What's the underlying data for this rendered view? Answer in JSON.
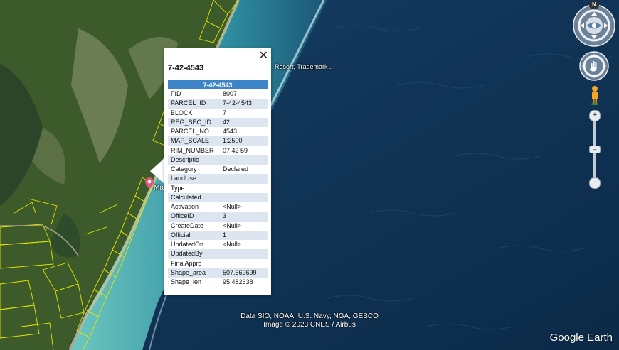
{
  "balloon": {
    "close_glyph": "✕",
    "title": "7-42-4543",
    "table_header": "7-42-4543",
    "rows": [
      {
        "key": "FID",
        "value": "8007"
      },
      {
        "key": "PARCEL_ID",
        "value": "7-42-4543"
      },
      {
        "key": "BLOCK",
        "value": "7"
      },
      {
        "key": "REG_SEC_ID",
        "value": "42"
      },
      {
        "key": "PARCEL_NO",
        "value": "4543"
      },
      {
        "key": "MAP_SCALE",
        "value": "1:2500"
      },
      {
        "key": "RIM_NUMBER",
        "value": "07 42 59"
      },
      {
        "key": "Descriptio",
        "value": ""
      },
      {
        "key": "Category",
        "value": "Declared"
      },
      {
        "key": "LandUse",
        "value": ""
      },
      {
        "key": "Type",
        "value": ""
      },
      {
        "key": "Calculated",
        "value": ""
      },
      {
        "key": "Activation",
        "value": "<Null>"
      },
      {
        "key": "OfficeID",
        "value": "3"
      },
      {
        "key": "CreateDate",
        "value": "<Null>"
      },
      {
        "key": "Official",
        "value": "1"
      },
      {
        "key": "UpdatedOn",
        "value": "<Null>"
      },
      {
        "key": "UpdatedBy",
        "value": ""
      },
      {
        "key": "FinalAppro",
        "value": ""
      },
      {
        "key": "Shape_area",
        "value": "507.669699"
      },
      {
        "key": "Shape_len",
        "value": "95.482638"
      }
    ]
  },
  "map_labels": {
    "resort": "Resort, Trademark ...",
    "place": "Ma"
  },
  "attribution": {
    "line1": "Data SIO, NOAA, U.S. Navy, NGA, GEBCO",
    "line2": "Image © 2023 CNES / Airbus"
  },
  "brand": "Google Earth",
  "nav": {
    "north_label": "N",
    "zoom_in": "+",
    "zoom_out": "−"
  },
  "colors": {
    "ocean_deep": "#0f3354",
    "reef_shallow": "#4fb3b0",
    "land": "#3f5a2c",
    "parcel_outline": "#e6e600",
    "table_header": "#3d85c6",
    "row_alt": "#dde6f0"
  }
}
